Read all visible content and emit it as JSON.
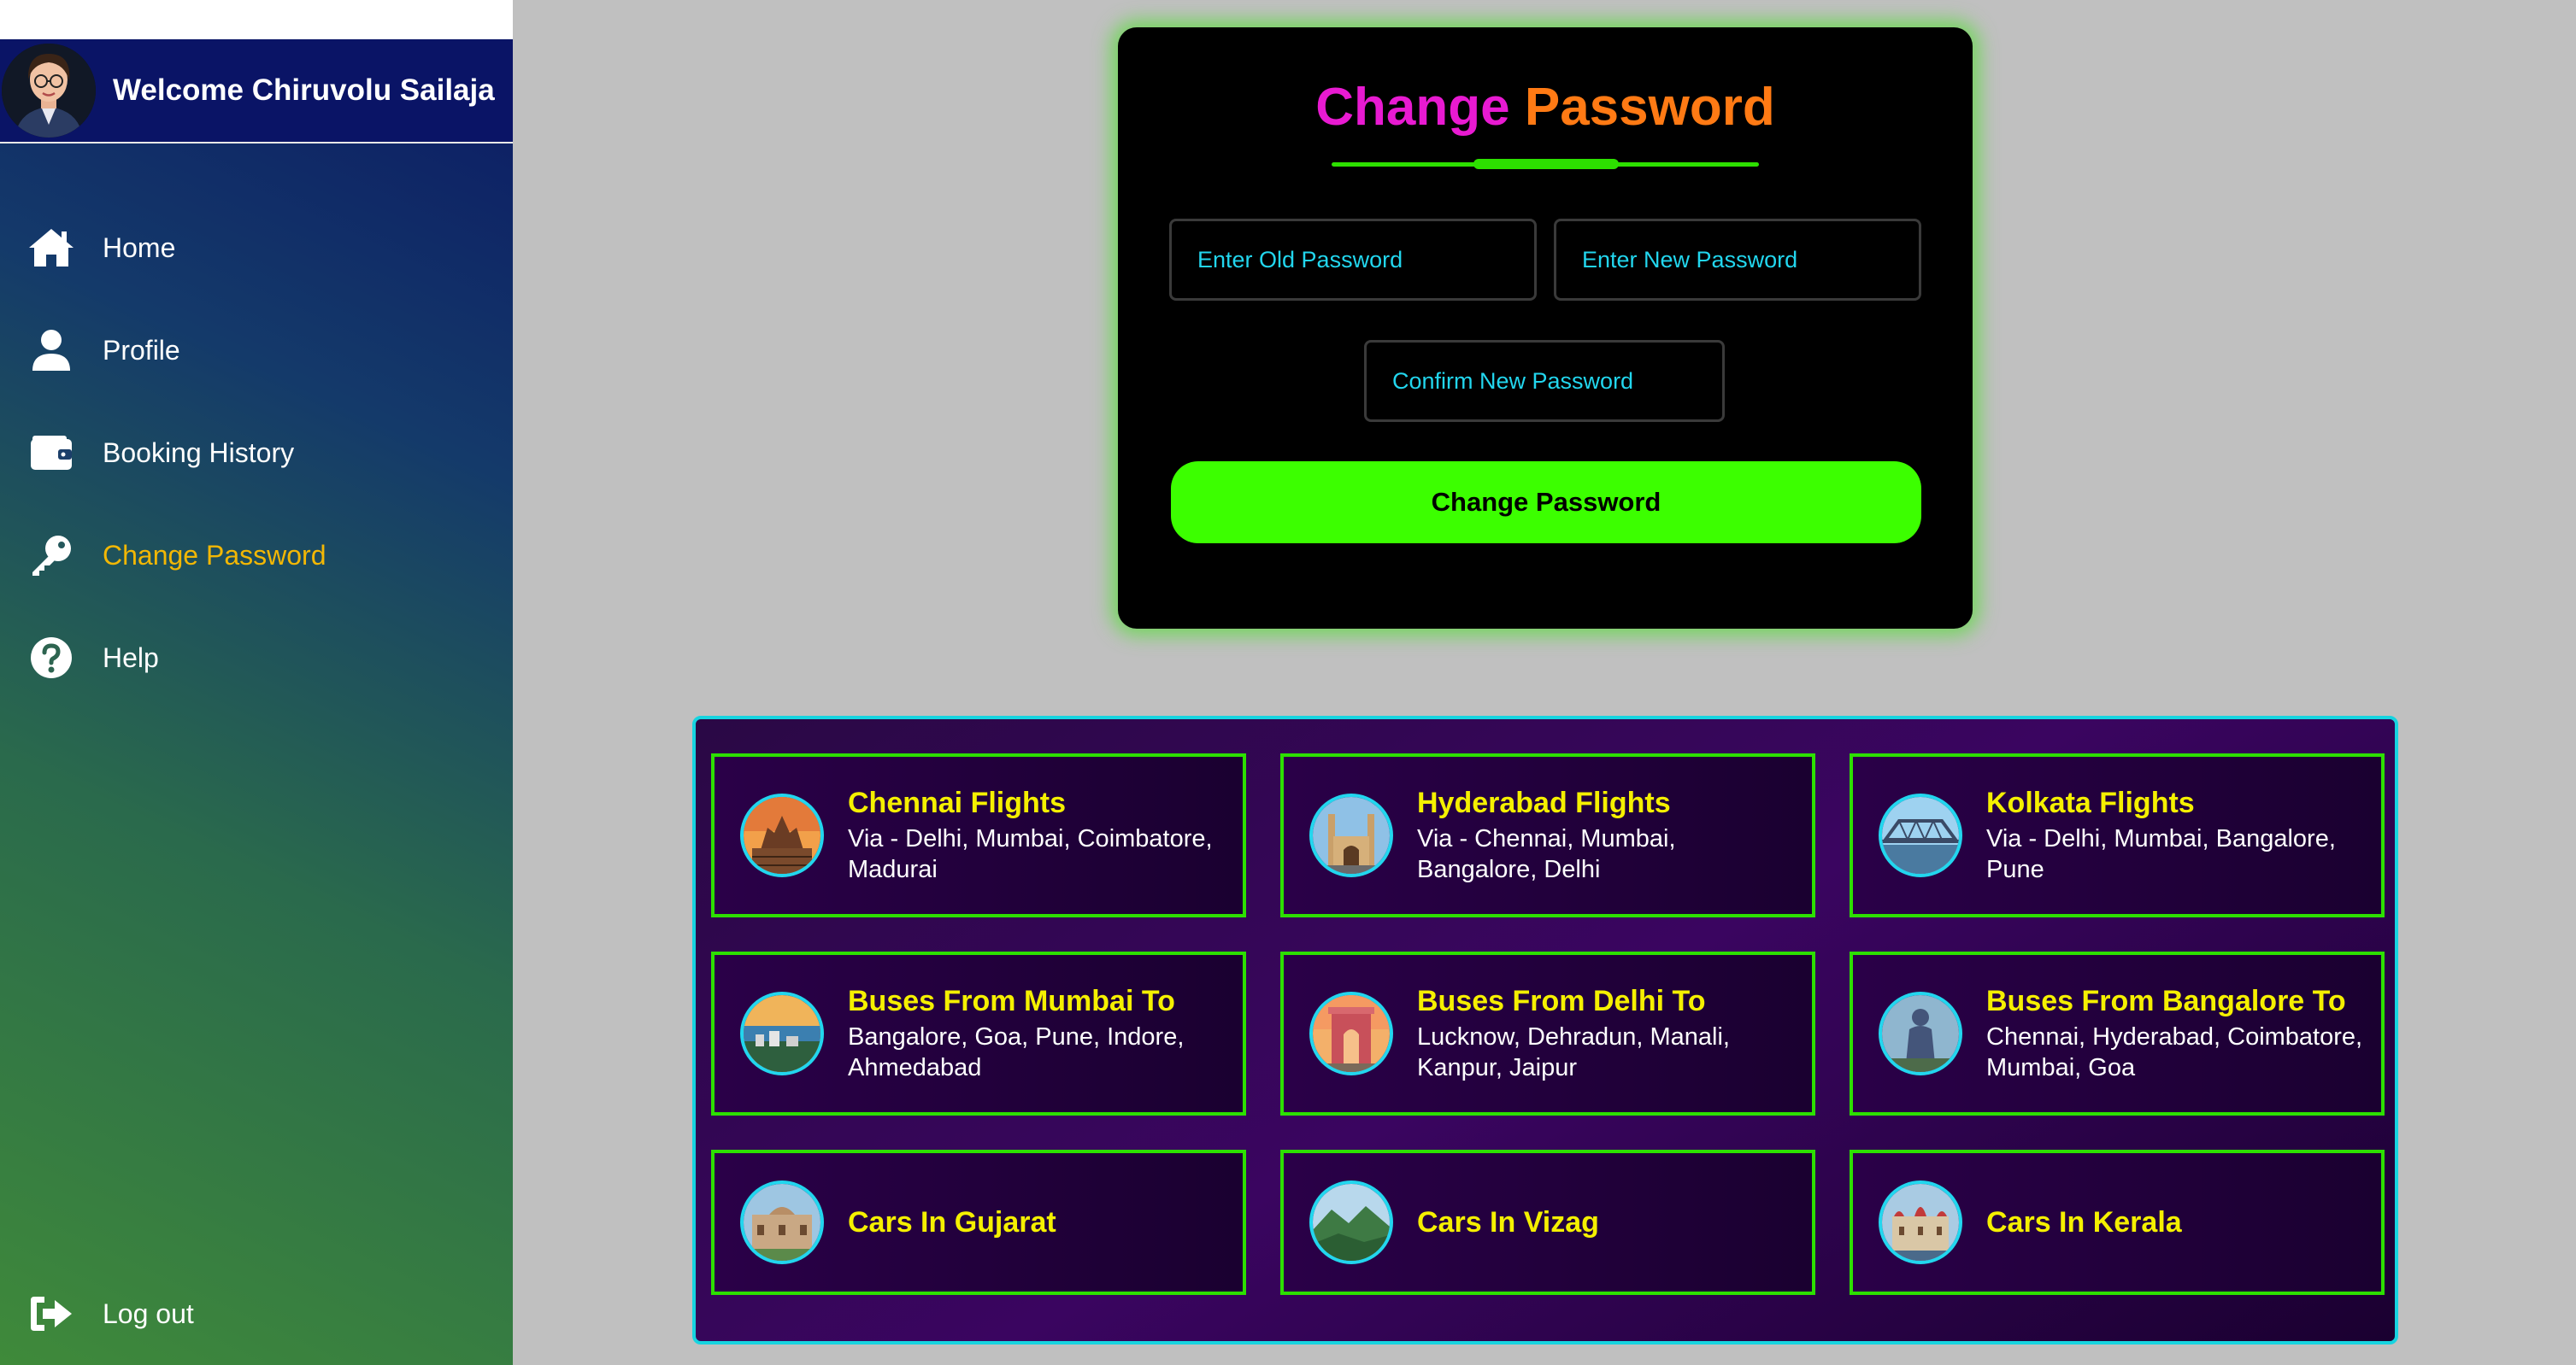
{
  "sidebar": {
    "welcome": "Welcome Chiruvolu Sailaja",
    "items": [
      {
        "label": "Home",
        "icon": "home-icon"
      },
      {
        "label": "Profile",
        "icon": "user-icon"
      },
      {
        "label": "Booking History",
        "icon": "wallet-icon"
      },
      {
        "label": "Change Password",
        "icon": "key-icon",
        "active": true
      },
      {
        "label": "Help",
        "icon": "question-circle-icon"
      }
    ],
    "logout": {
      "label": "Log out",
      "icon": "sign-out-icon"
    }
  },
  "form": {
    "title_part1": "Change",
    "title_part2": "Password",
    "old_placeholder": "Enter Old Password",
    "new_placeholder": "Enter New Password",
    "confirm_placeholder": "Confirm New Password",
    "submit_label": "Change Password"
  },
  "destinations": [
    {
      "title": "Chennai Flights",
      "lines": [
        "Via - Delhi, Mumbai, Coimbatore,",
        "Madurai"
      ]
    },
    {
      "title": "Hyderabad Flights",
      "lines": [
        "Via - Chennai, Mumbai,",
        "Bangalore, Delhi"
      ]
    },
    {
      "title": "Kolkata Flights",
      "lines": [
        "Via - Delhi, Mumbai, Bangalore,",
        "Pune"
      ]
    },
    {
      "title": "Buses From Mumbai To",
      "lines": [
        "Bangalore, Goa, Pune, Indore,",
        "Ahmedabad"
      ]
    },
    {
      "title": "Buses From Delhi To",
      "lines": [
        "Lucknow, Dehradun, Manali,",
        "Kanpur, Jaipur"
      ]
    },
    {
      "title": "Buses From Bangalore To",
      "lines": [
        "Chennai, Hyderabad, Coimbatore,",
        "Mumbai, Goa"
      ]
    },
    {
      "title": "Cars In Gujarat",
      "lines": []
    },
    {
      "title": "Cars In Vizag",
      "lines": []
    },
    {
      "title": "Cars In Kerala",
      "lines": []
    }
  ],
  "colors": {
    "active_nav": "#f2b705",
    "title_magenta": "#e81ad1",
    "title_orange": "#ff7a14",
    "accent_green": "#3cff00",
    "placeholder_cyan": "#22d6ee",
    "tile_title_yellow": "#f5f000"
  }
}
